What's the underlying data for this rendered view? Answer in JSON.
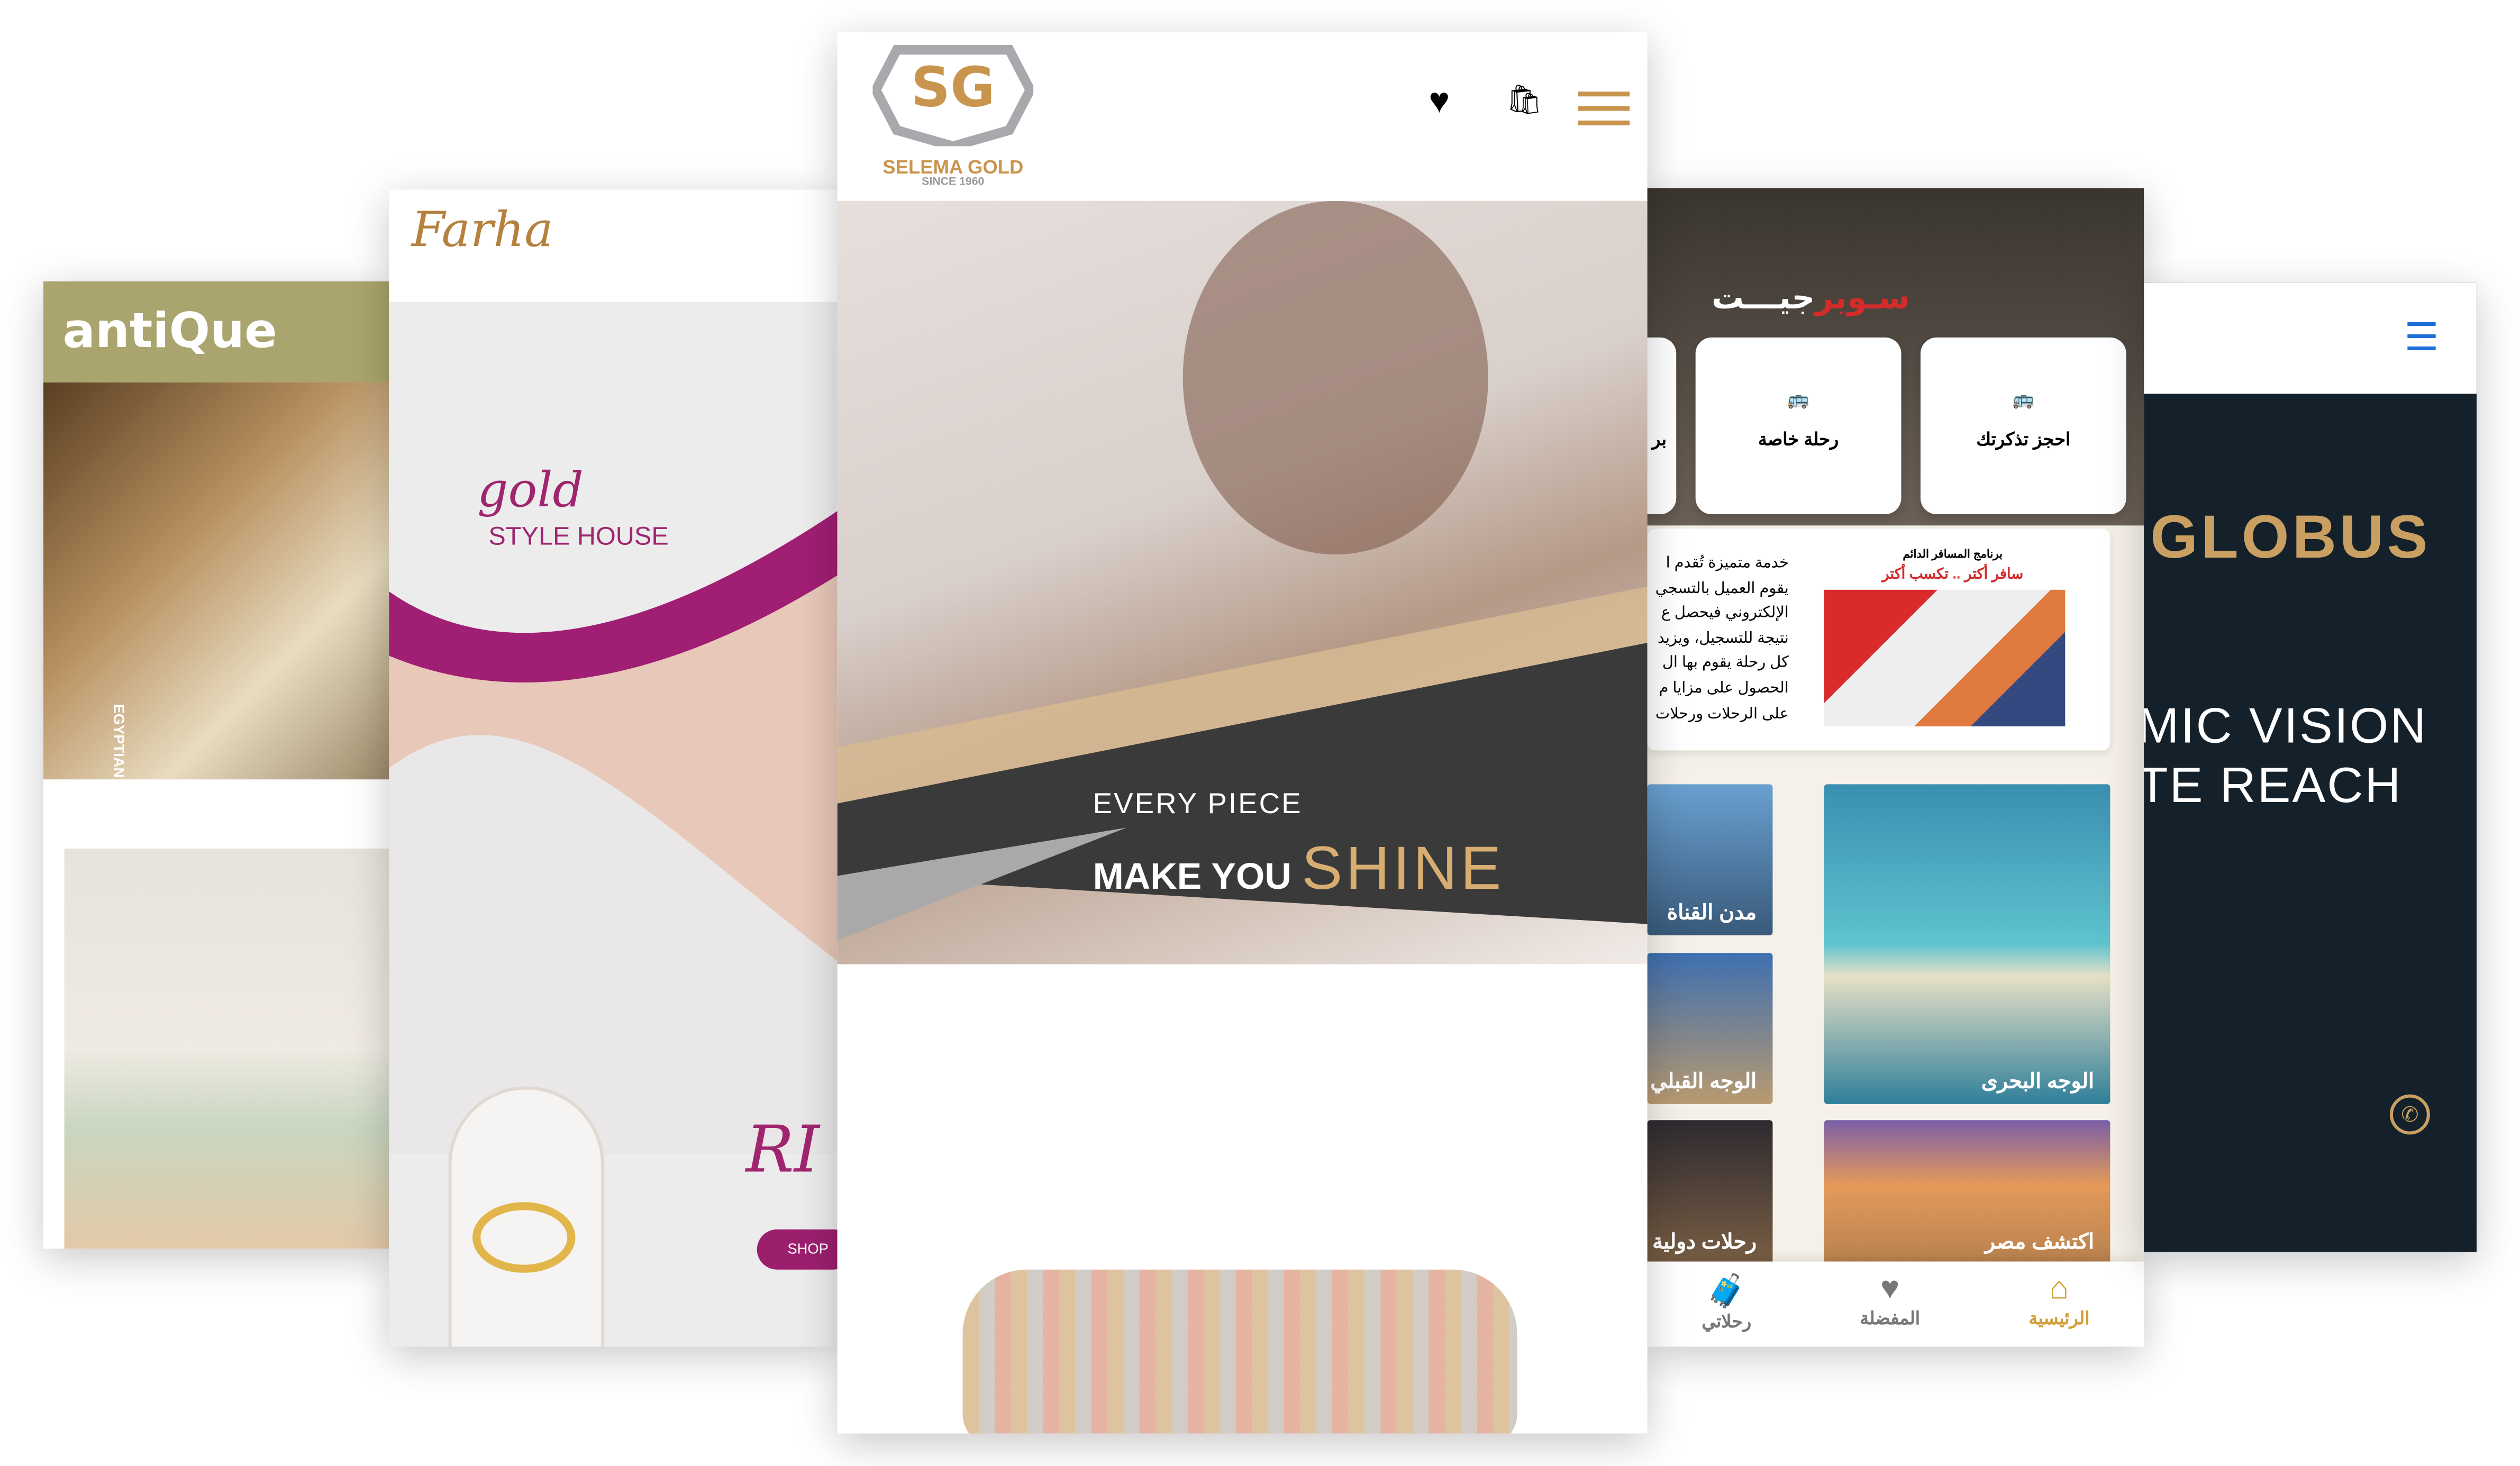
{
  "antique": {
    "logo": "antiQue",
    "vertical_text": "EGYPTIAN HOME  ·  EGYPTIAN ACCESSORIES"
  },
  "farha": {
    "logo": "Farha",
    "gold": "gold",
    "style_house": "STYLE HOUSE",
    "script_text": "RI",
    "shop_button": "SHOP"
  },
  "selema": {
    "brand": "SELEMA GOLD",
    "since": "SINCE 1960",
    "logo_mark": "SG",
    "heart_icon": "♥",
    "bag_icon": "🛍",
    "hero_line1": "EVERY PIECE",
    "hero_line2": "MAKE YOU",
    "hero_line3": "SHINE"
  },
  "superjet": {
    "logo_white": "جيـــت",
    "logo_red": "سـوبر",
    "tiles": [
      {
        "label": "احجز تذكرتك"
      },
      {
        "label": "رحلة خاصة"
      },
      {
        "label": "بر"
      }
    ],
    "promo": {
      "title": "برنامج المسافر الدائم",
      "slogan": "سافر أكتر .. تكسب أكتر",
      "lines": [
        "خدمة متميزة تُقدم ا",
        "يقوم العميل بالتسجي",
        "الإلكتروني فيحصل ع",
        "نتيجة للتسجيل، ويزيد",
        "كل رحلة يقوم بها ال",
        "الحصول على مزايا م",
        "على الرحلات ورحلات"
      ]
    },
    "destinations": [
      "الوجه البحرى",
      "مدن القناة",
      "الوجه القبلي",
      "اكتشف مصر",
      "رحلات دولية"
    ],
    "nav": [
      {
        "label": "الرئيسية",
        "icon": "⌂",
        "active": true
      },
      {
        "label": "المفضلة",
        "icon": "♥"
      },
      {
        "label": "رحلاتي",
        "icon": "🧳"
      }
    ]
  },
  "globus": {
    "title": "GLOBUS",
    "line1": "MIC VISION",
    "line2": "TE REACH",
    "menu_icon": "☰",
    "whatsapp_icon": "✆"
  },
  "colors": {
    "gold": "#c9954e",
    "purple": "#9c1f6e",
    "navy": "#14212b",
    "jet_gold": "#d2a03a",
    "blue": "#1e6fd9"
  }
}
